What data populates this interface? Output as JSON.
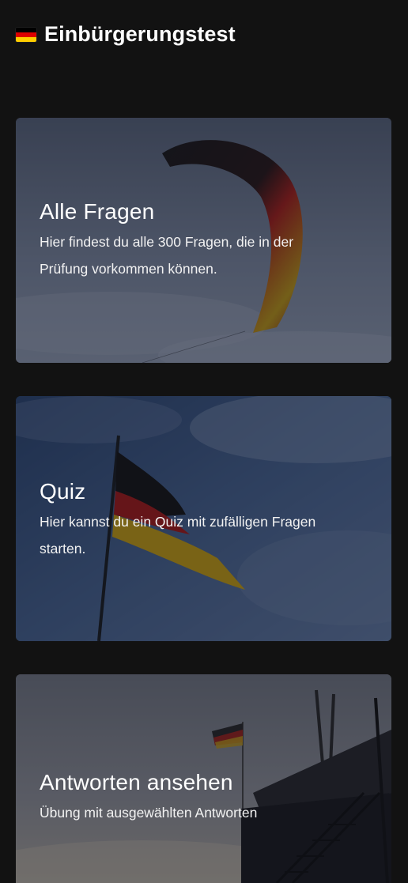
{
  "app": {
    "title": "Einbürgerungstest",
    "flag_icon": "german-flag-icon"
  },
  "cards": [
    {
      "title": "Alle Fragen",
      "description": "Hier findest du alle 300 Fragen, die in der Prüfung vorkommen können.",
      "image": "kite-german-colors-photo"
    },
    {
      "title": "Quiz",
      "description": "Hier kannst du ein Quiz mit zufälligen Fragen starten.",
      "image": "german-flag-on-pole-photo"
    },
    {
      "title": "Antworten ansehen",
      "description": "Übung mit ausgewählten Antworten",
      "image": "flag-and-lifeguard-tower-photo"
    }
  ],
  "colors": {
    "background": "#121212",
    "flag_black": "#000000",
    "flag_red": "#dd0000",
    "flag_gold": "#ffce00"
  }
}
